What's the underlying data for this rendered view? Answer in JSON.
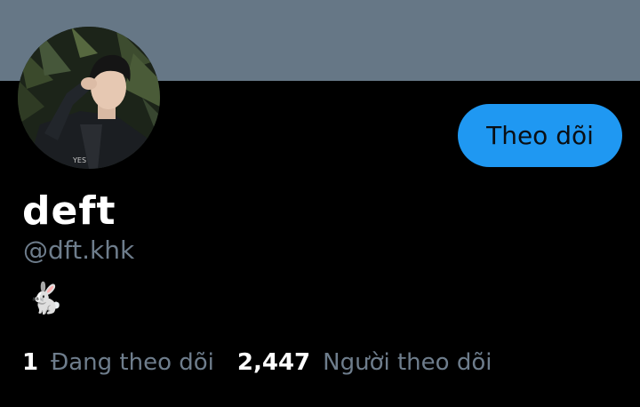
{
  "profile": {
    "display_name": "deft",
    "handle": "@dft.khk",
    "bio": "🐇",
    "follow_label": "Theo dõi",
    "banner_color": "#667786",
    "accent_color": "#1f98f2"
  },
  "stats": {
    "following_count": "1",
    "following_label": "Đang theo dõi",
    "followers_count": "2,447",
    "followers_label": "Người theo dõi"
  }
}
